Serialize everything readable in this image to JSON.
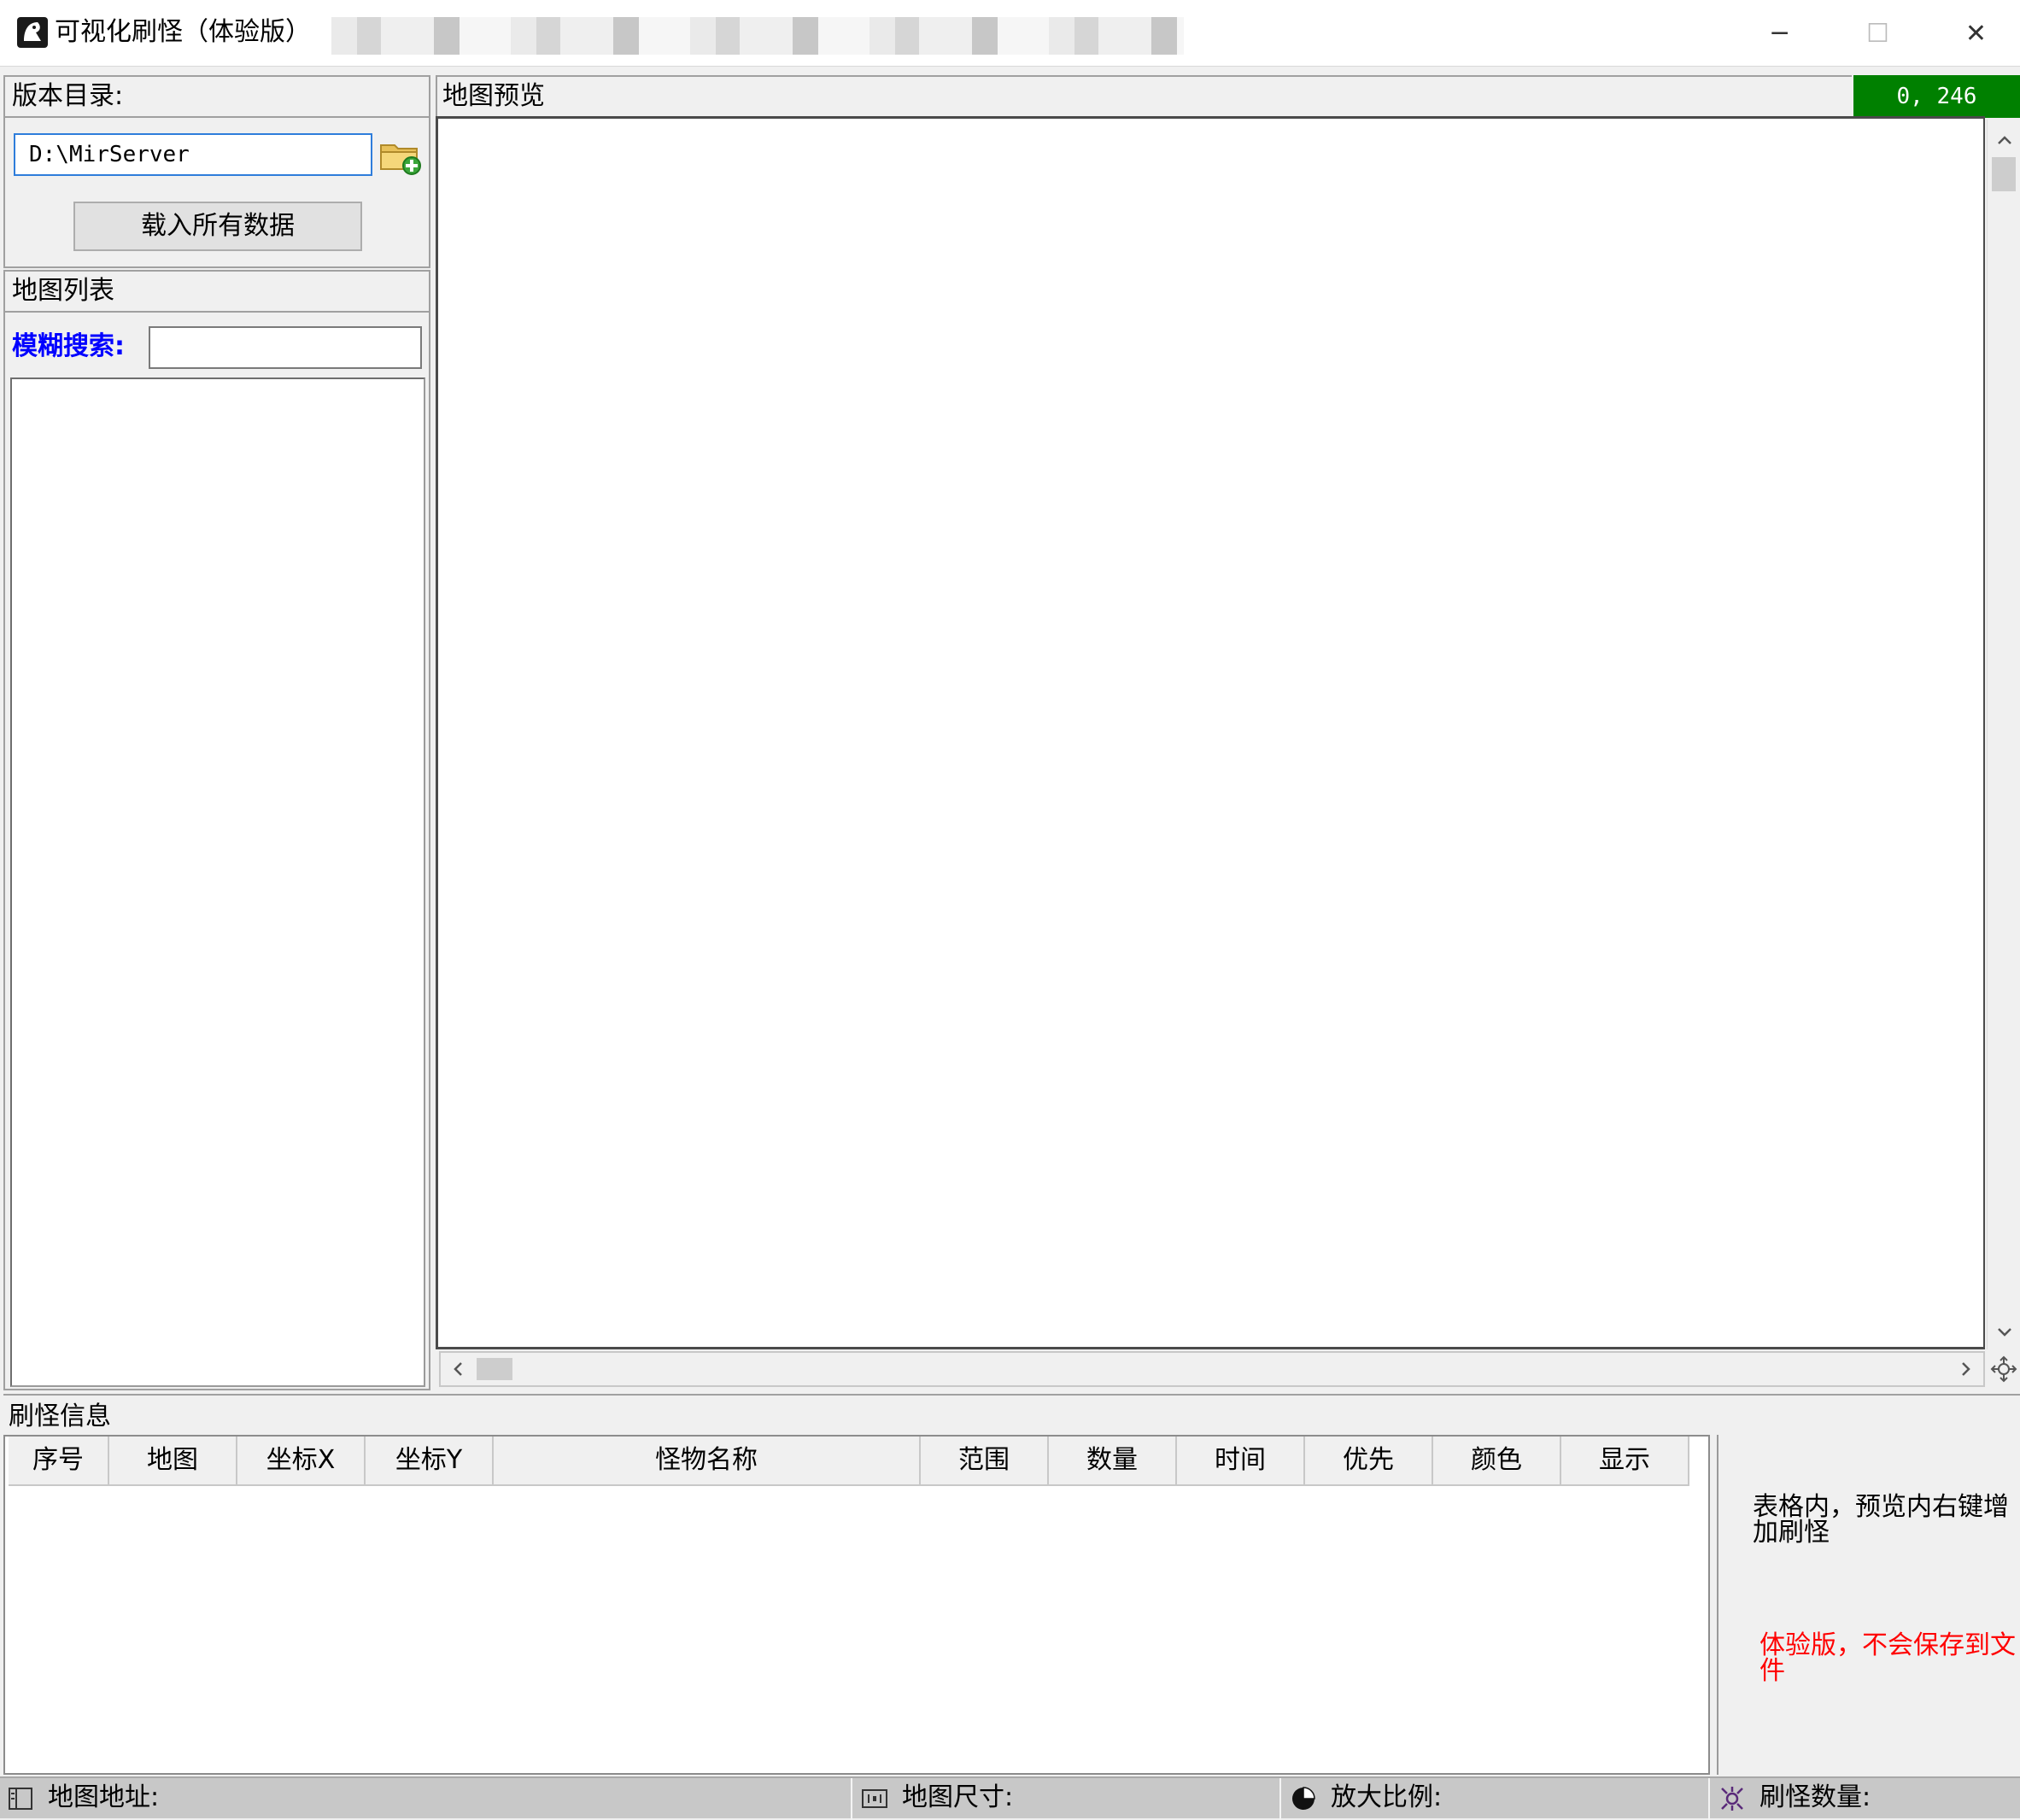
{
  "window": {
    "title": "可视化刷怪（体验版）",
    "minimize_glyph": "─",
    "maximize_glyph": "☐",
    "close_glyph": "✕"
  },
  "version_dir": {
    "label": "版本目录:",
    "path_value": "D:\\MirServer",
    "load_button": "载入所有数据",
    "folder_icon": "folder-add-icon"
  },
  "map_list": {
    "label": "地图列表",
    "search_label": "模糊搜索:",
    "search_value": ""
  },
  "map_preview": {
    "label": "地图预览",
    "coords": "0, 246",
    "coords_color": "#008000"
  },
  "spawn_info": {
    "label": "刷怪信息",
    "columns": [
      "序号",
      "地图",
      "坐标X",
      "坐标Y",
      "怪物名称",
      "范围",
      "数量",
      "时间",
      "优先",
      "颜色",
      "显示"
    ],
    "rows": [],
    "hint": "表格内，预览内右键增加刷怪",
    "warning": "体验版，不会保存到文件",
    "warning_color": "#ff0000"
  },
  "status_bar": {
    "map_address_label": "地图地址:",
    "map_size_label": "地图尺寸:",
    "zoom_label": "放大比例:",
    "spawn_count_label": "刷怪数量:"
  }
}
